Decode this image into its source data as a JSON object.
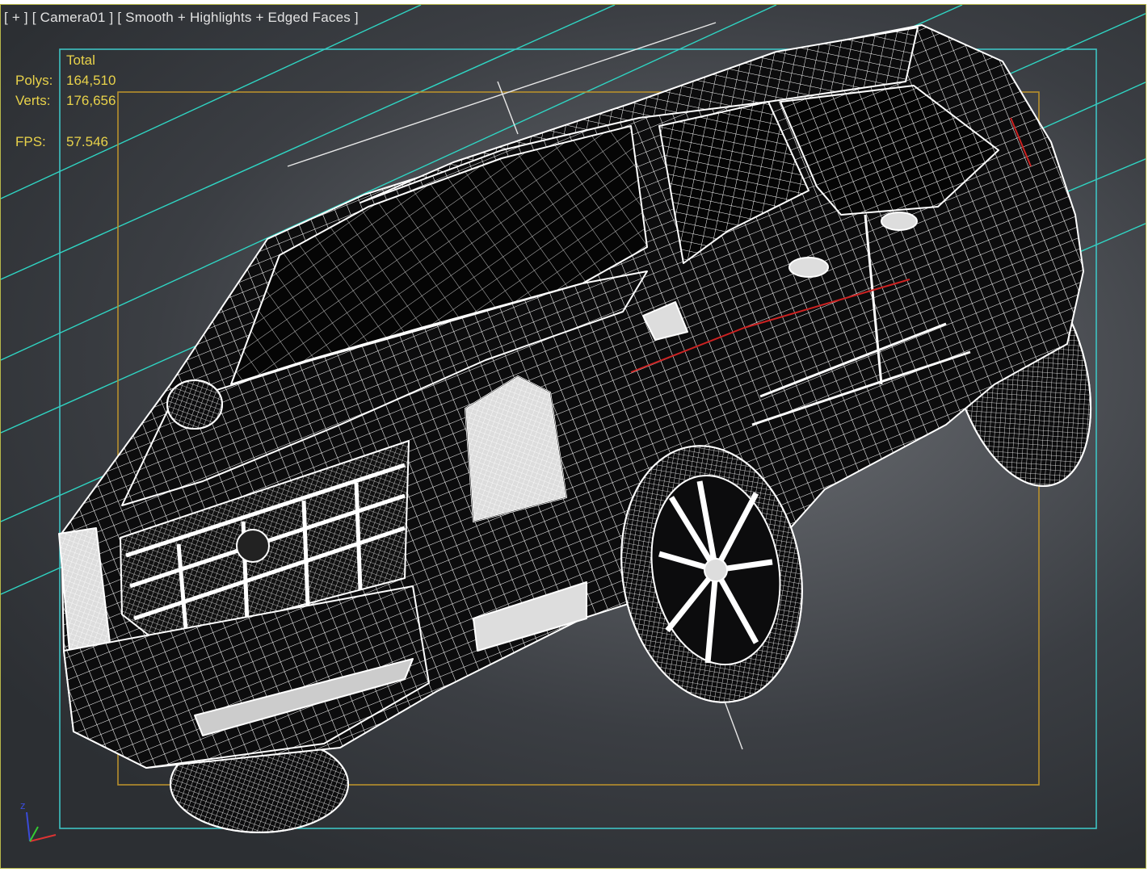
{
  "viewport": {
    "label": "[ + ] [ Camera01 ] [ Smooth + Highlights + Edged Faces ]",
    "stats": {
      "header": "Total",
      "polys_label": "Polys:",
      "polys_value": "164,510",
      "verts_label": "Verts:",
      "verts_value": "176,656",
      "fps_label": "FPS:",
      "fps_value": "57.546"
    },
    "axis": {
      "z_label": "z"
    },
    "colors": {
      "stats_text": "#e8d24a",
      "safe_frame_outer": "#3ec3c3",
      "safe_frame_inner": "#b8902c",
      "grid_lines": "#2fd6c4",
      "wireframe": "#ffffff",
      "body_fill": "#0c0c0d",
      "selection_accent": "#cc2222"
    }
  }
}
